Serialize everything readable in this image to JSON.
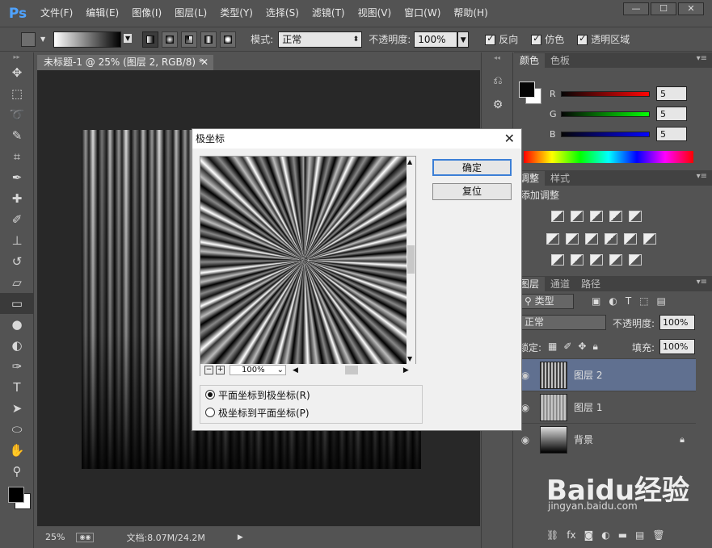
{
  "app": {
    "logo": "Ps"
  },
  "menu": [
    "文件(F)",
    "编辑(E)",
    "图像(I)",
    "图层(L)",
    "类型(Y)",
    "选择(S)",
    "滤镜(T)",
    "视图(V)",
    "窗口(W)",
    "帮助(H)"
  ],
  "window_controls": {
    "min": "—",
    "max": "☐",
    "close": "✕"
  },
  "options": {
    "mode_label": "模式:",
    "mode_value": "正常",
    "opacity_label": "不透明度:",
    "opacity_value": "100%",
    "reverse_label": "反向",
    "dither_label": "仿色",
    "transparency_label": "透明区域"
  },
  "document": {
    "tab_title": "未标题-1 @ 25% (图层 2, RGB/8) *",
    "zoom": "25%",
    "doc_info": "文档:8.07M/24.2M"
  },
  "color_panel": {
    "tabs": [
      "颜色",
      "色板"
    ],
    "r_label": "R",
    "r_value": "5",
    "g_label": "G",
    "g_value": "5",
    "b_label": "B",
    "b_value": "5",
    "foreground": "#050505",
    "background": "#ffffff"
  },
  "adjustments_panel": {
    "tabs": [
      "调整",
      "样式"
    ],
    "title": "添加调整"
  },
  "layers_panel": {
    "tabs": [
      "图层",
      "通道",
      "路径"
    ],
    "filter_label": "类型",
    "blend_mode": "正常",
    "opacity_label": "不透明度:",
    "opacity_value": "100%",
    "lock_label": "锁定:",
    "fill_label": "填充:",
    "fill_value": "100%",
    "layers": [
      {
        "name": "图层 2",
        "selected": true
      },
      {
        "name": "图层 1",
        "selected": false
      },
      {
        "name": "背景",
        "selected": false
      }
    ]
  },
  "dialog": {
    "title": "极坐标",
    "ok_label": "确定",
    "reset_label": "复位",
    "zoom_value": "100%",
    "option_rect_to_polar": "平面坐标到极坐标(R)",
    "option_polar_to_rect": "极坐标到平面坐标(P)",
    "selected_option": "rect_to_polar"
  },
  "watermark": {
    "brand": "Baidu经验",
    "url": "jingyan.baidu.com"
  }
}
